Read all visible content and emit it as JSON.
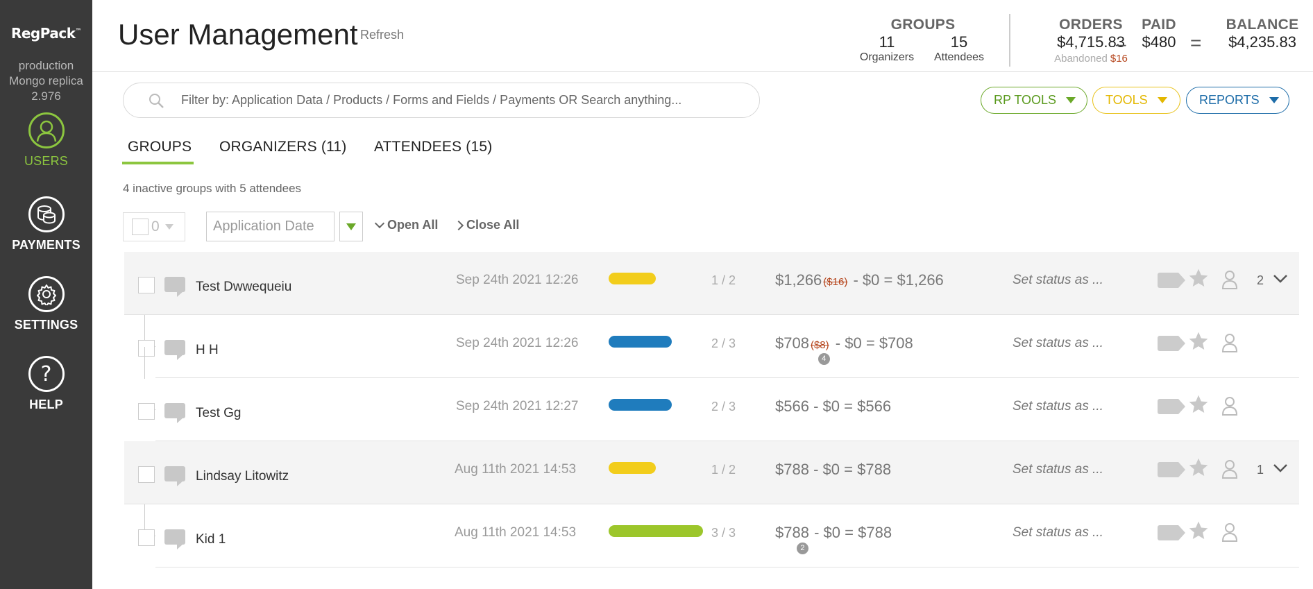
{
  "sidebar": {
    "logo": "RegPack",
    "logo_tm": "™",
    "environment": [
      "production",
      "Mongo replica",
      "2.976"
    ],
    "items": [
      {
        "label": "USERS",
        "icon": "user-icon",
        "active": true
      },
      {
        "label": "PAYMENTS",
        "icon": "coins-icon",
        "active": false
      },
      {
        "label": "SETTINGS",
        "icon": "gear-icon",
        "active": false
      },
      {
        "label": "HELP",
        "icon": "question-icon",
        "active": false
      }
    ]
  },
  "header": {
    "title": "User Management",
    "refresh": "Refresh",
    "groups": {
      "label": "GROUPS",
      "organizers_count": "11",
      "organizers_label": "Organizers",
      "attendees_count": "15",
      "attendees_label": "Attendees"
    },
    "orders": {
      "label": "ORDERS",
      "value": "$4,715.83",
      "abandoned_label": "Abandoned",
      "abandoned_value": "$16"
    },
    "paid": {
      "label": "PAID",
      "value": "$480"
    },
    "balance": {
      "label": "BALANCE",
      "value": "$4,235.83"
    },
    "minus": "–",
    "equals": "="
  },
  "search": {
    "placeholder": "Filter by: Application Data / Products / Forms and Fields / Payments OR Search anything..."
  },
  "tools": {
    "rp_tools": "RP TOOLS",
    "tools": "TOOLS",
    "reports": "REPORTS"
  },
  "tabs": [
    {
      "label": "GROUPS",
      "active": true
    },
    {
      "label": "ORGANIZERS (11)",
      "active": false
    },
    {
      "label": "ATTENDEES (15)",
      "active": false
    }
  ],
  "inactive_note": "4 inactive groups with 5 attendees",
  "toolbar": {
    "selected_count": "0",
    "sort_field": "Application Date",
    "open_all": "Open All",
    "close_all": "Close All"
  },
  "rows": [
    {
      "type": "parent",
      "name": "Test Dwwequeiu",
      "date": "Sep 24th 2021 12:26",
      "bar_color": "#f2cd1b",
      "progress": 0.5,
      "ratio": "1 / 2",
      "orders": "$1,266",
      "abandoned": "($16)",
      "badge": "",
      "paid": "$0",
      "balance": "$1,266",
      "status": "Set status as ...",
      "child_count": "2"
    },
    {
      "type": "child",
      "name": "H H",
      "date": "Sep 24th 2021 12:26",
      "bar_color": "#1f7cbd",
      "progress": 0.667,
      "ratio": "2 / 3",
      "orders": "$708",
      "abandoned": "($8)",
      "badge": "4",
      "paid": "$0",
      "balance": "$708",
      "status": "Set status as ..."
    },
    {
      "type": "child",
      "name": "Test Gg",
      "date": "Sep 24th 2021 12:27",
      "bar_color": "#1f7cbd",
      "progress": 0.667,
      "ratio": "2 / 3",
      "orders": "$566",
      "abandoned": "",
      "badge": "",
      "paid": "$0",
      "balance": "$566",
      "status": "Set status as ..."
    },
    {
      "type": "parent",
      "name": "Lindsay Litowitz",
      "date": "Aug 11th 2021 14:53",
      "bar_color": "#f2cd1b",
      "progress": 0.5,
      "ratio": "1 / 2",
      "orders": "$788",
      "abandoned": "",
      "badge": "",
      "paid": "$0",
      "balance": "$788",
      "status": "Set status as ...",
      "child_count": "1"
    },
    {
      "type": "child",
      "name": "Kid 1",
      "date": "Aug 11th 2021 14:53",
      "bar_color": "#9cc62b",
      "progress": 1.0,
      "ratio": "3 / 3",
      "orders": "$788",
      "abandoned": "",
      "badge": "2",
      "paid": "$0",
      "balance": "$788",
      "status": "Set status as ..."
    }
  ],
  "money_ops": {
    "minus": "-",
    "equals": "="
  }
}
